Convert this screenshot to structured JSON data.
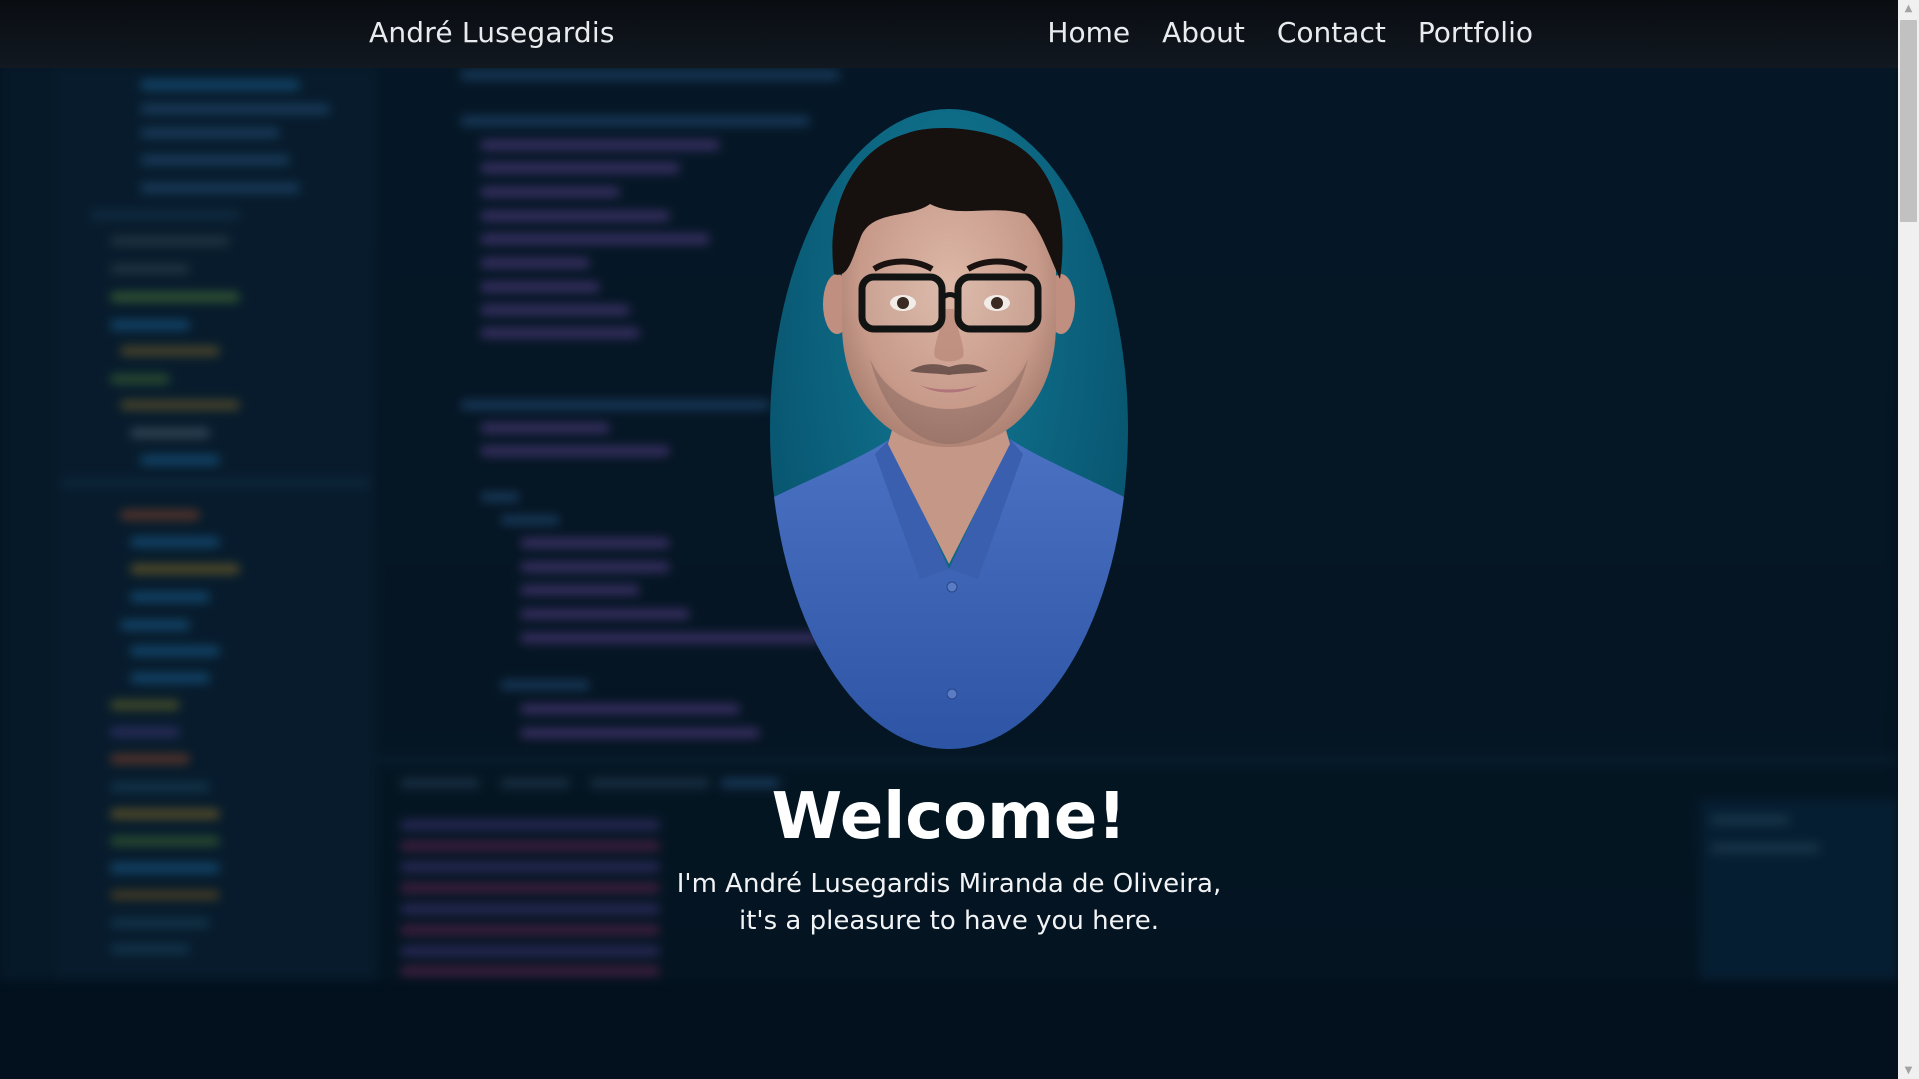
{
  "navbar": {
    "brand": "André Lusegardis",
    "links": [
      {
        "label": "Home"
      },
      {
        "label": "About"
      },
      {
        "label": "Contact"
      },
      {
        "label": "Portfolio"
      }
    ]
  },
  "hero": {
    "title": "Welcome!",
    "intro_line1": "I'm André Lusegardis Miranda de Oliveira,",
    "intro_line2": "it's a pleasure to have you here."
  },
  "scrollbar": {
    "up_icon": "chevron-up-icon",
    "down_icon": "chevron-down-icon"
  },
  "colors": {
    "background": "#03111e",
    "navbar": "#111820",
    "text": "#ffffff",
    "portrait_bg": "#0b5f7a",
    "shirt": "#3d63b3"
  }
}
